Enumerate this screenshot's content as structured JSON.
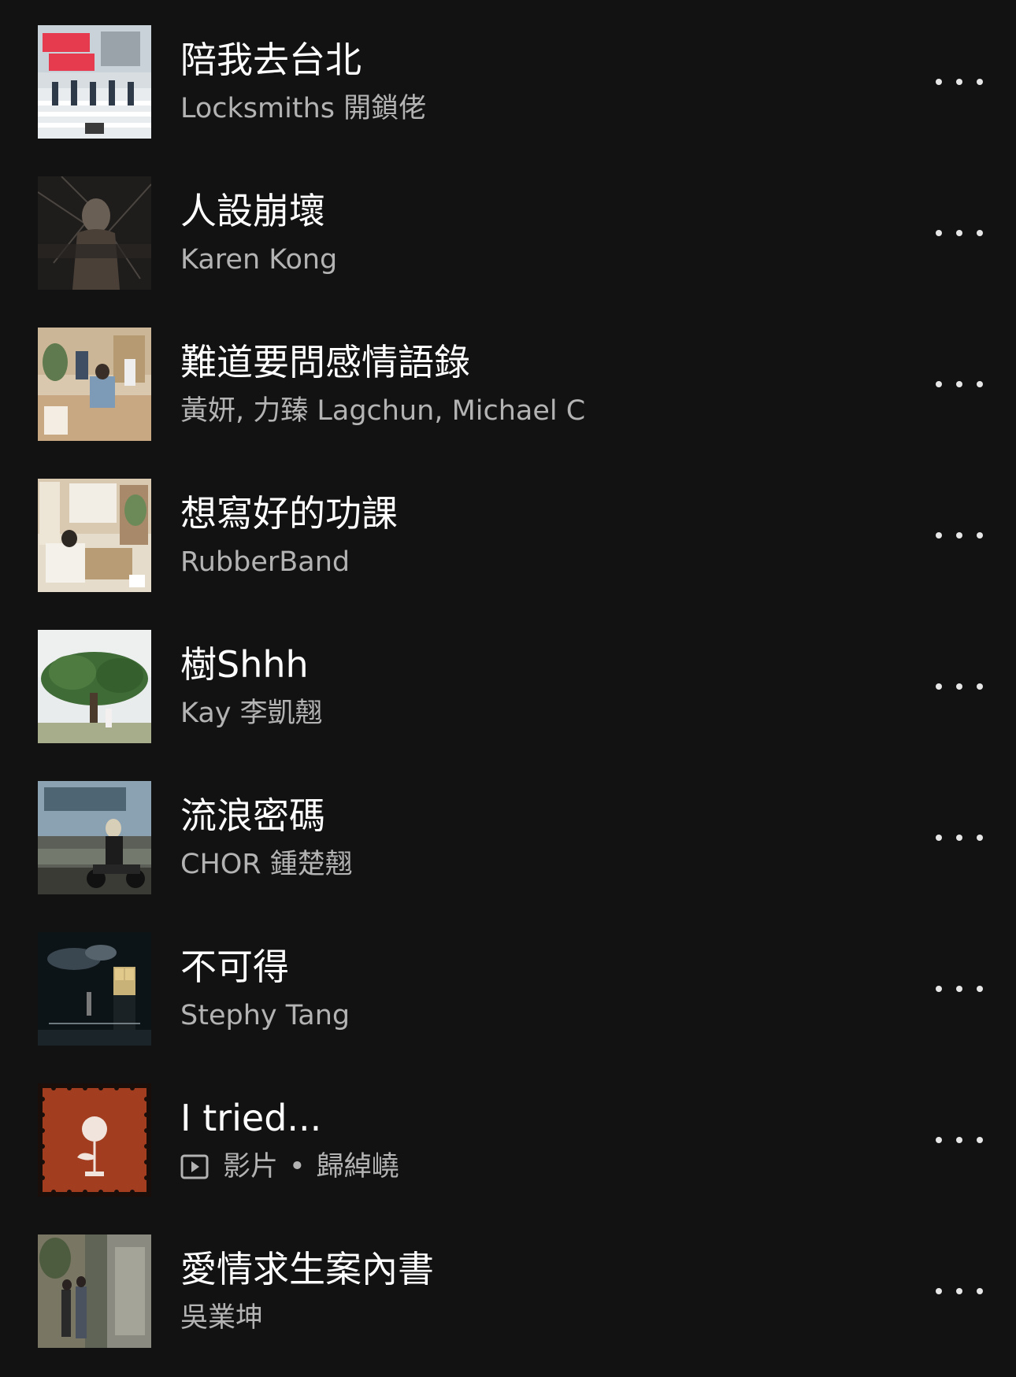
{
  "tracks": [
    {
      "title": "陪我去台北",
      "artist": "Locksmiths 開鎖佬"
    },
    {
      "title": "人設崩壞",
      "artist": "Karen Kong"
    },
    {
      "title": "難道要問感情語錄",
      "artist": "黃妍, 力臻 Lagchun, Michael C"
    },
    {
      "title": "想寫好的功課",
      "artist": "RubberBand"
    },
    {
      "title": "樹Shhh",
      "artist": "Kay 李凱翹"
    },
    {
      "title": "流浪密碼",
      "artist": "CHOR 鍾楚翹"
    },
    {
      "title": "不可得",
      "artist": "Stephy Tang"
    },
    {
      "title": "I tried...",
      "type_label": "影片",
      "separator": "•",
      "artist": "歸綽嶢"
    },
    {
      "title": "愛情求生案內書",
      "artist": "吳業坤"
    }
  ],
  "icons": {
    "more": "more-options-icon",
    "video": "video-icon"
  },
  "colors": {
    "background": "#121212",
    "title": "#ffffff",
    "subtitle": "#b3b3b3"
  }
}
